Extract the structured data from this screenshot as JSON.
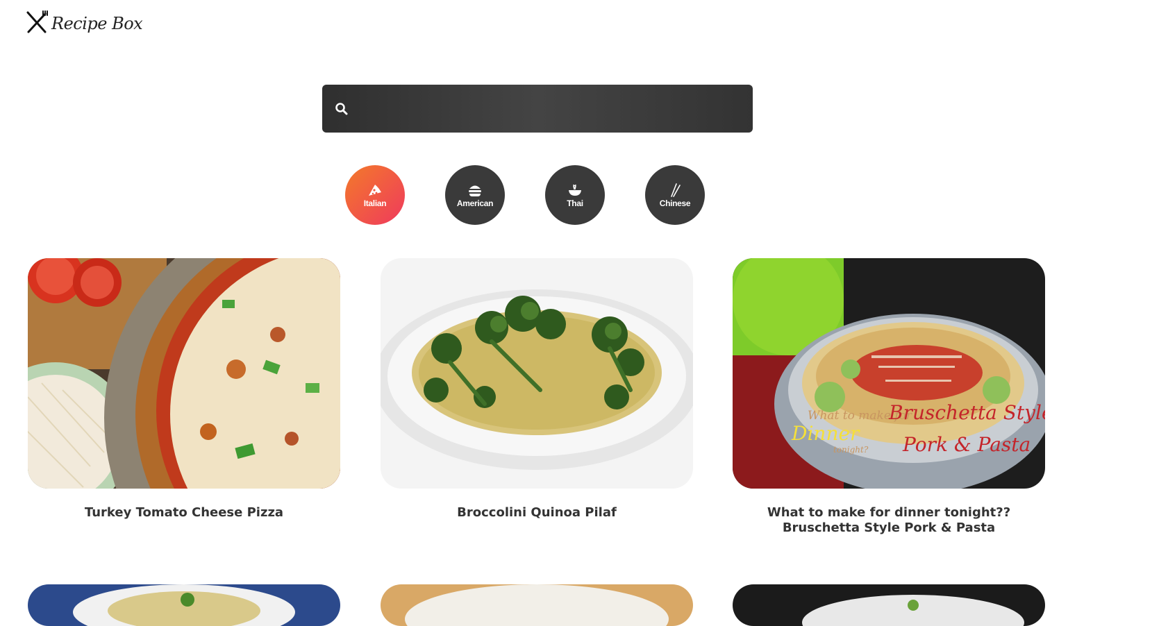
{
  "header": {
    "logo_text": "Recipe Box",
    "logo_icon": "fork-knife-cross-icon"
  },
  "search": {
    "placeholder": "",
    "value": "",
    "icon": "search-icon"
  },
  "categories": [
    {
      "label": "Italian",
      "icon": "pizza-icon",
      "active": true
    },
    {
      "label": "American",
      "icon": "burger-icon",
      "active": false
    },
    {
      "label": "Thai",
      "icon": "noodle-bowl-icon",
      "active": false
    },
    {
      "label": "Chinese",
      "icon": "chopsticks-icon",
      "active": false
    }
  ],
  "recipes": [
    {
      "title": "Turkey Tomato Cheese Pizza"
    },
    {
      "title": "Broccolini Quinoa Pilaf"
    },
    {
      "title": "What to make for dinner tonight?? Bruschetta Style Pork & Pasta"
    }
  ],
  "image_overlay_text": {
    "line1": "What to make for",
    "line2": "Dinner",
    "line3": "tonight?",
    "line4": "Bruschetta Style",
    "line5": "Pork & Pasta"
  },
  "colors": {
    "accent_start": "#f37a2a",
    "accent_end": "#ef3a5d",
    "dark": "#3a3a3a"
  }
}
